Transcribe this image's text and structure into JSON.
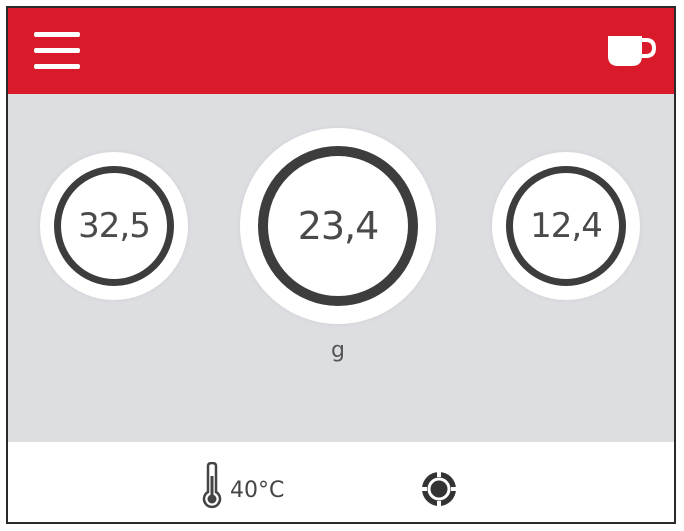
{
  "header": {
    "menu_icon": "hamburger-menu-icon",
    "cup_icon": "coffee-cup-icon",
    "accent_color": "#d91a2a"
  },
  "dials": {
    "left": {
      "value": "32,5"
    },
    "center": {
      "value": "23,4"
    },
    "right": {
      "value": "12,4"
    },
    "unit": "g"
  },
  "footer": {
    "thermometer_icon": "thermometer-icon",
    "temperature": "40°C",
    "settings_icon": "grinder-disc-icon"
  }
}
